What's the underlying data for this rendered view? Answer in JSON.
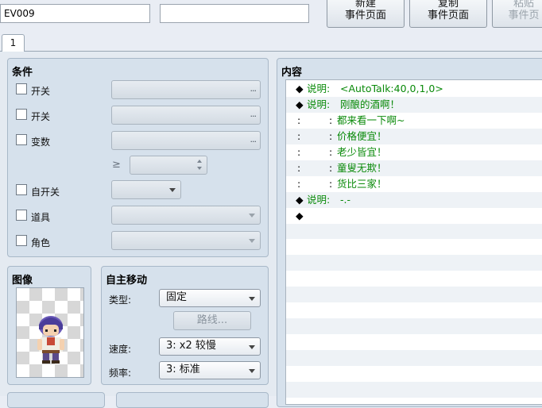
{
  "top": {
    "id_value": "EV009",
    "memo_value": "",
    "buttons": [
      {
        "line1": "新建",
        "line2": "事件页面"
      },
      {
        "line1": "复制",
        "line2": "事件页面"
      },
      {
        "line1": "粘贴",
        "line2": "事件页"
      }
    ]
  },
  "tabs": [
    {
      "label": "1"
    }
  ],
  "conditions": {
    "title": "条件",
    "rows": [
      {
        "label": "开关"
      },
      {
        "label": "开关"
      },
      {
        "label": "变数"
      },
      {
        "label": "自开关"
      },
      {
        "label": "道具"
      },
      {
        "label": "角色"
      }
    ],
    "ge_symbol": "≥",
    "dots": "..."
  },
  "image": {
    "title": "图像"
  },
  "autonomous": {
    "title": "自主移动",
    "type_label": "类型:",
    "type_value": "固定",
    "route_button": "路线...",
    "speed_label": "速度:",
    "speed_value": "3: x2 较慢",
    "freq_label": "频率:",
    "freq_value": "3: 标准"
  },
  "contents": {
    "title": "内容",
    "lines": [
      {
        "prefix": "◆",
        "keyword": "说明:",
        "text": "<AutoTalk:40,0,1,0>"
      },
      {
        "prefix": "◆",
        "keyword": "说明:",
        "text": " 刚酿的酒啊！"
      },
      {
        "prefix": ":",
        "keyword": "     :",
        "text": " 都来看一下啊~"
      },
      {
        "prefix": ":",
        "keyword": "     :",
        "text": " 价格便宜！"
      },
      {
        "prefix": ":",
        "keyword": "     :",
        "text": " 老少皆宜！"
      },
      {
        "prefix": ":",
        "keyword": "     :",
        "text": " 童叟无欺！"
      },
      {
        "prefix": ":",
        "keyword": "     :",
        "text": " 货比三家！"
      },
      {
        "prefix": "◆",
        "keyword": "说明:",
        "text": "-.-"
      },
      {
        "prefix": "◆",
        "keyword": "",
        "text": ""
      }
    ]
  }
}
